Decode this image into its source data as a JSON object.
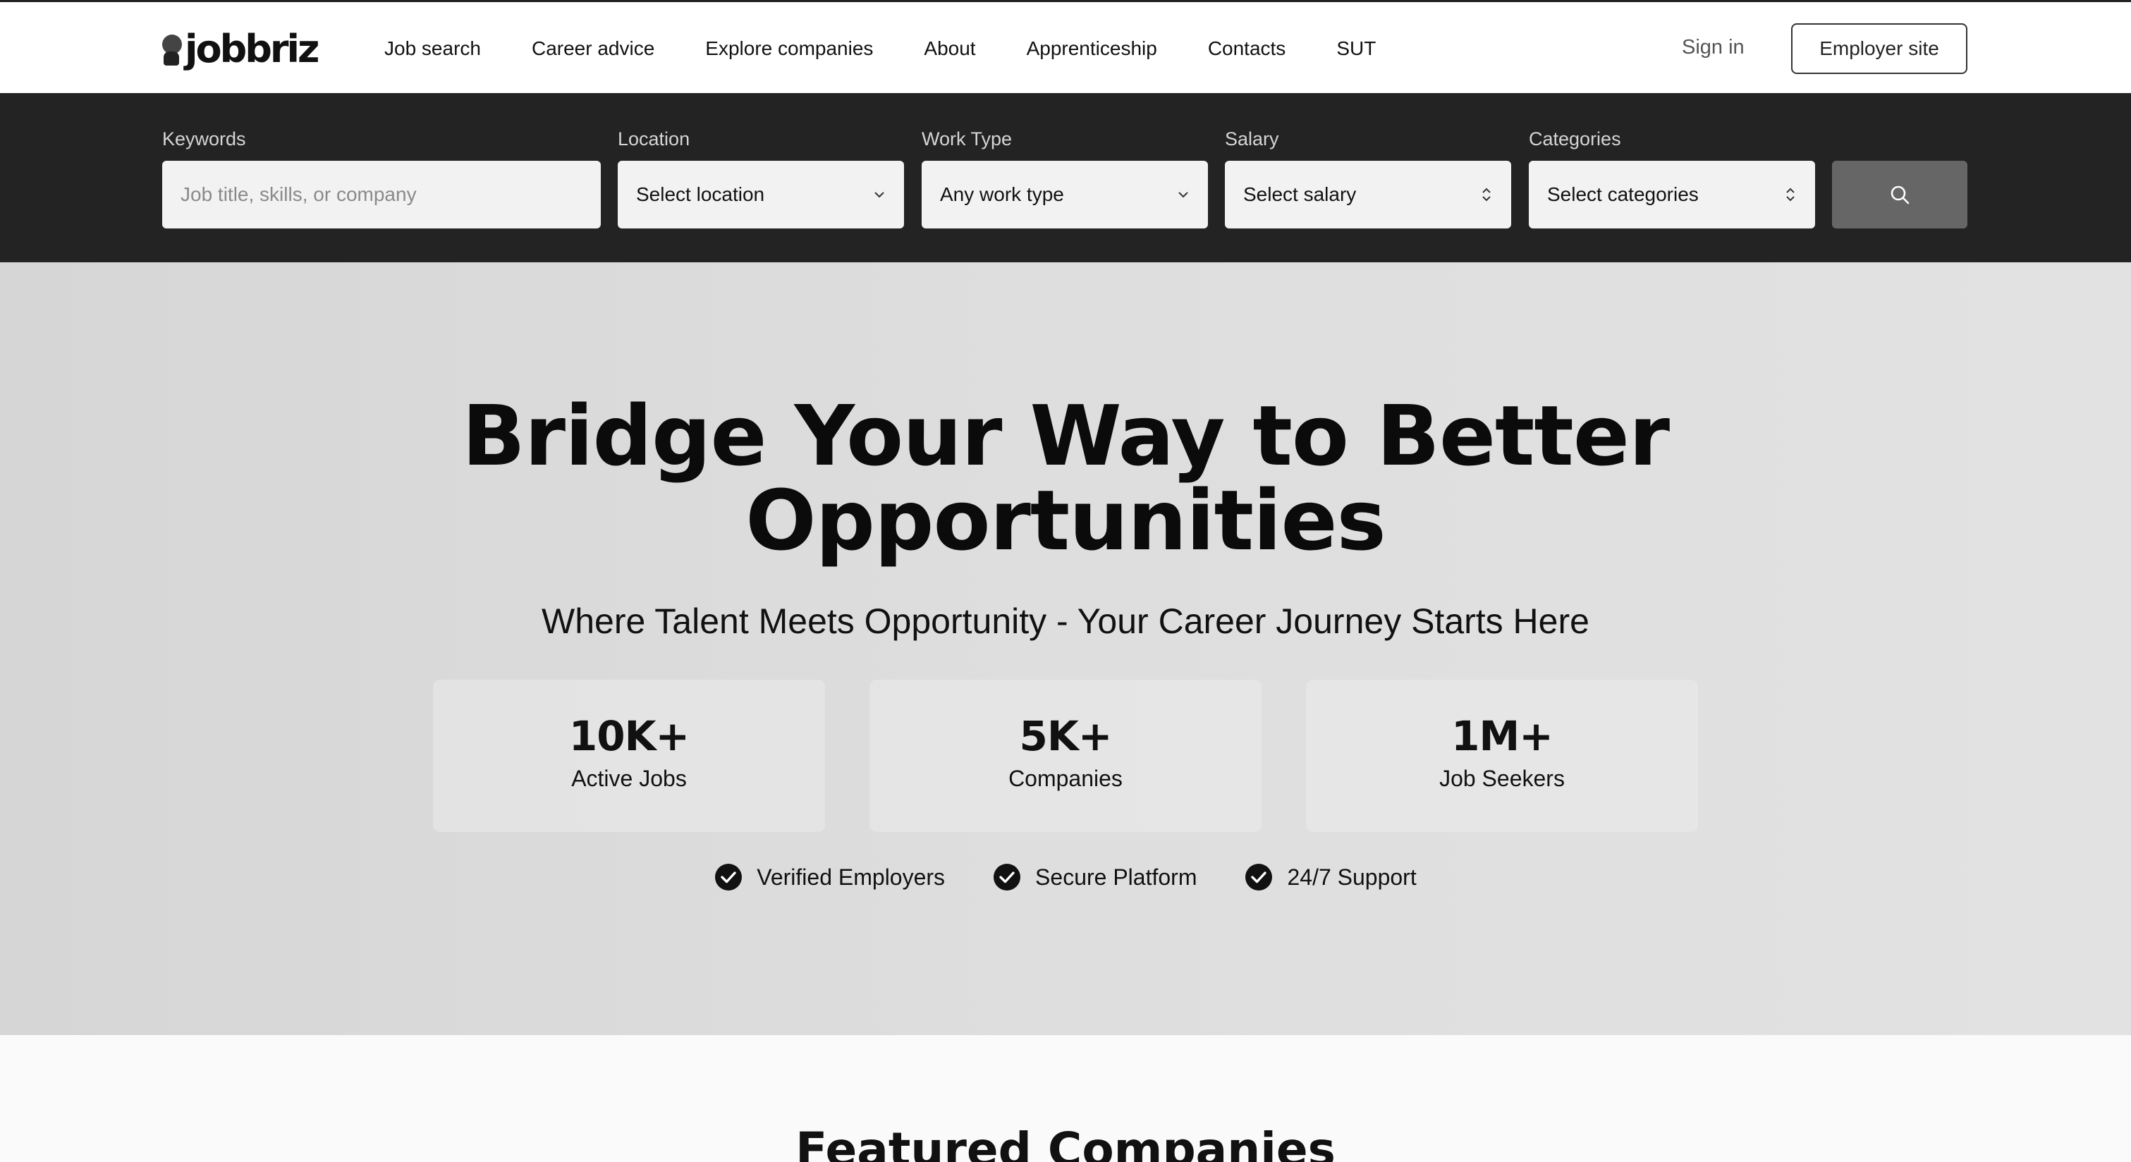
{
  "brand": {
    "name": "jobbriz",
    "logo_icon": "person-icon"
  },
  "nav": {
    "items": [
      {
        "label": "Job search"
      },
      {
        "label": "Career advice"
      },
      {
        "label": "Explore companies"
      },
      {
        "label": "About"
      },
      {
        "label": "Apprenticeship"
      },
      {
        "label": "Contacts"
      },
      {
        "label": "SUT"
      }
    ],
    "sign_in": "Sign in",
    "employer_site": "Employer site"
  },
  "search": {
    "keywords": {
      "label": "Keywords",
      "placeholder": "Job title, skills, or company",
      "value": ""
    },
    "location": {
      "label": "Location",
      "value": "Select location",
      "icon": "chevron-down-icon"
    },
    "work_type": {
      "label": "Work Type",
      "value": "Any work type",
      "icon": "chevron-down-icon"
    },
    "salary": {
      "label": "Salary",
      "value": "Select salary",
      "icon": "chevron-updown-icon"
    },
    "categories": {
      "label": "Categories",
      "value": "Select categories",
      "icon": "chevron-updown-icon"
    },
    "button_icon": "search-icon"
  },
  "hero": {
    "title_line1": "Bridge Your Way to Better",
    "title_line2": "Opportunities",
    "subtitle": "Where Talent Meets Opportunity - Your Career Journey Starts Here",
    "stats": [
      {
        "value": "10K+",
        "label": "Active Jobs"
      },
      {
        "value": "5K+",
        "label": "Companies"
      },
      {
        "value": "1M+",
        "label": "Job Seekers"
      }
    ],
    "badges": [
      {
        "label": "Verified Employers",
        "icon": "check-circle-icon"
      },
      {
        "label": "Secure Platform",
        "icon": "check-circle-icon"
      },
      {
        "label": "24/7 Support",
        "icon": "check-circle-icon"
      }
    ]
  },
  "featured": {
    "title": "Featured Companies"
  },
  "colors": {
    "search_band": "#232323",
    "search_button": "#666666",
    "hero_bg": "#dcdcdc"
  }
}
